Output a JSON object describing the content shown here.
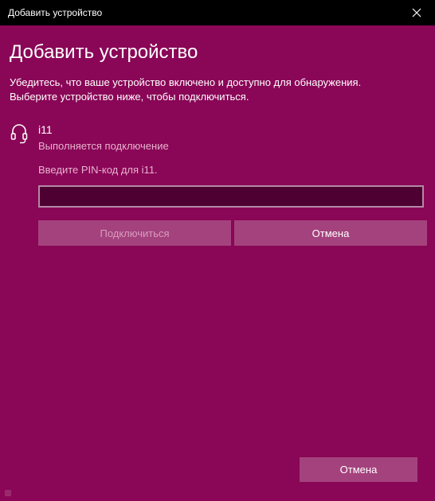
{
  "window": {
    "title": "Добавить устройство",
    "close_icon": "close-icon"
  },
  "main": {
    "heading": "Добавить устройство",
    "description_line1": "Убедитесь, что ваше устройство включено и доступно для обнаружения.",
    "description_line2": "Выберите устройство ниже, чтобы подключиться."
  },
  "device": {
    "icon": "headset-icon",
    "name": "i11",
    "status": "Выполняется подключение",
    "pin_prompt": "Введите PIN-код для i11.",
    "pin_value": "",
    "connect_label": "Подключиться",
    "cancel_label": "Отмена"
  },
  "footer": {
    "cancel_label": "Отмена"
  },
  "colors": {
    "accent_background": "#8a0657",
    "titlebar": "#000000",
    "button": "#a4427d",
    "input_background": "#4e0032"
  }
}
